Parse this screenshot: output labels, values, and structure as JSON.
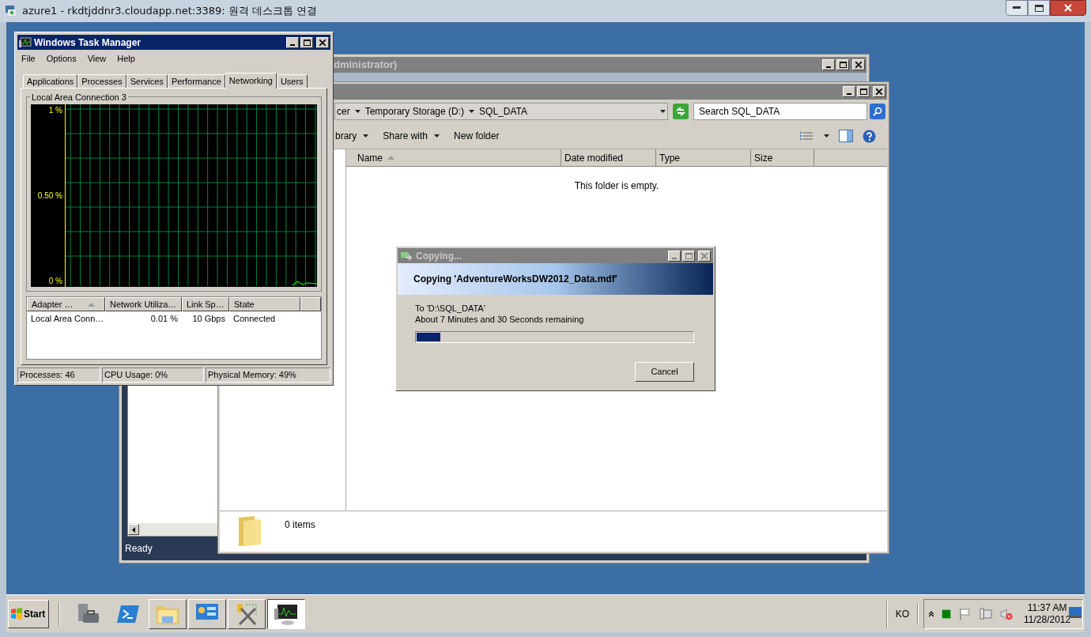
{
  "rdp_window": {
    "title": "azure1 - rkdtjddnr3.cloudapp.net:3389: 원격 데스크톱 연결"
  },
  "back_window": {
    "title": "dministrator)",
    "status": "Ready"
  },
  "explorer": {
    "breadcrumb": [
      "cer",
      "Temporary Storage (D:)",
      "SQL_DATA"
    ],
    "search_placeholder": "Search SQL_DATA",
    "toolbar": [
      {
        "label": "brary",
        "menu": true
      },
      {
        "label": "Share with",
        "menu": true
      },
      {
        "label": "New folder",
        "menu": false
      }
    ],
    "columns": [
      {
        "label": "Name",
        "sorted": true
      },
      {
        "label": "Date modified",
        "sorted": false
      },
      {
        "label": "Type",
        "sorted": false
      },
      {
        "label": "Size",
        "sorted": false
      }
    ],
    "empty_message": "This folder is empty.",
    "details": "0 items"
  },
  "task_manager": {
    "title": "Windows Task Manager",
    "menu": [
      "File",
      "Options",
      "View",
      "Help"
    ],
    "tabs": [
      {
        "label": "Applications",
        "selected": false
      },
      {
        "label": "Processes",
        "selected": false
      },
      {
        "label": "Services",
        "selected": false
      },
      {
        "label": "Performance",
        "selected": false
      },
      {
        "label": "Networking",
        "selected": true
      },
      {
        "label": "Users",
        "selected": false
      }
    ],
    "graph": {
      "title": "Local Area Connection 3",
      "axis_labels": [
        "1 %",
        "0.50 %",
        "0 %"
      ]
    },
    "columns": [
      {
        "label": "Adapter …",
        "sorted": true
      },
      {
        "label": "Network Utiliza…",
        "sorted": false
      },
      {
        "label": "Link Sp…",
        "sorted": false
      },
      {
        "label": "State",
        "sorted": false
      }
    ],
    "rows": [
      [
        "Local Area Conn…",
        "0.01 %",
        "10 Gbps",
        "Connected"
      ]
    ],
    "status": [
      "Processes: 46",
      "CPU Usage: 0%",
      "Physical Memory: 49%"
    ]
  },
  "copy_dialog": {
    "title": "Copying...",
    "heading": "Copying 'AdventureWorksDW2012_Data.mdf'",
    "destination": "To 'D:\\SQL_DATA'",
    "remaining": "About 7 Minutes and 30 Seconds remaining",
    "progress": {
      "level": 0.085
    },
    "button": "Cancel"
  },
  "taskbar": {
    "start": "Start",
    "apps": [
      {
        "kind": "server",
        "running": false,
        "selected": false
      },
      {
        "kind": "shell",
        "running": false,
        "selected": false
      },
      {
        "kind": "folder",
        "running": true,
        "selected": false
      },
      {
        "kind": "panel",
        "running": true,
        "selected": false
      },
      {
        "kind": "tools",
        "running": true,
        "selected": false
      },
      {
        "kind": "monitor",
        "running": true,
        "selected": true
      }
    ],
    "language": "KO",
    "time": "11:37 AM",
    "date": "11/28/2012"
  }
}
